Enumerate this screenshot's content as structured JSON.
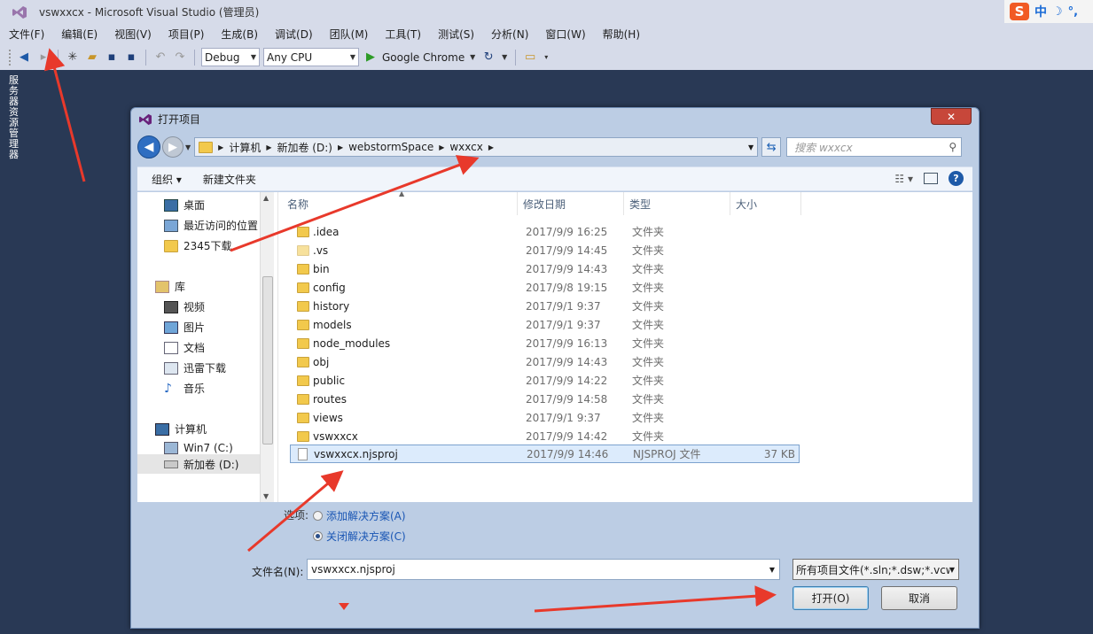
{
  "window": {
    "title": "vswxxcx - Microsoft Visual Studio (管理员)"
  },
  "ime": {
    "logo": "S",
    "lang": "中",
    "moon": "☽",
    "punct": "°,"
  },
  "menu": [
    "文件(F)",
    "编辑(E)",
    "视图(V)",
    "项目(P)",
    "生成(B)",
    "调试(D)",
    "团队(M)",
    "工具(T)",
    "测试(S)",
    "分析(N)",
    "窗口(W)",
    "帮助(H)"
  ],
  "toolbar": {
    "config": "Debug",
    "platform": "Any CPU",
    "run_target": "Google Chrome"
  },
  "side_tab": {
    "label": "服务器资源管理器"
  },
  "dialog": {
    "title": "打开项目",
    "close": "✕",
    "breadcrumb": [
      "计算机",
      "新加卷 (D:)",
      "webstormSpace",
      "wxxcx"
    ],
    "search_placeholder": "搜索 wxxcx",
    "organize": "组织 ▾",
    "new_folder": "新建文件夹",
    "help": "?",
    "nav": {
      "favorites": [
        "桌面",
        "最近访问的位置",
        "2345下载"
      ],
      "library": "库",
      "libraries": [
        "视频",
        "图片",
        "文档",
        "迅雷下载",
        "音乐"
      ],
      "computer": "计算机",
      "drives": [
        "Win7 (C:)",
        "新加卷 (D:)"
      ]
    },
    "columns": [
      "名称",
      "修改日期",
      "类型",
      "大小"
    ],
    "files": [
      {
        "name": ".idea",
        "date": "2017/9/9 16:25",
        "type": "文件夹",
        "size": ""
      },
      {
        "name": ".vs",
        "date": "2017/9/9 14:45",
        "type": "文件夹",
        "size": ""
      },
      {
        "name": "bin",
        "date": "2017/9/9 14:43",
        "type": "文件夹",
        "size": ""
      },
      {
        "name": "config",
        "date": "2017/9/8 19:15",
        "type": "文件夹",
        "size": ""
      },
      {
        "name": "history",
        "date": "2017/9/1 9:37",
        "type": "文件夹",
        "size": ""
      },
      {
        "name": "models",
        "date": "2017/9/1 9:37",
        "type": "文件夹",
        "size": ""
      },
      {
        "name": "node_modules",
        "date": "2017/9/9 16:13",
        "type": "文件夹",
        "size": ""
      },
      {
        "name": "obj",
        "date": "2017/9/9 14:43",
        "type": "文件夹",
        "size": ""
      },
      {
        "name": "public",
        "date": "2017/9/9 14:22",
        "type": "文件夹",
        "size": ""
      },
      {
        "name": "routes",
        "date": "2017/9/9 14:58",
        "type": "文件夹",
        "size": ""
      },
      {
        "name": "views",
        "date": "2017/9/1 9:37",
        "type": "文件夹",
        "size": ""
      },
      {
        "name": "vswxxcx",
        "date": "2017/9/9 14:42",
        "type": "文件夹",
        "size": ""
      },
      {
        "name": "vswxxcx.njsproj",
        "date": "2017/9/9 14:46",
        "type": "NJSPROJ 文件",
        "size": "37 KB"
      }
    ],
    "options_label": "选项:",
    "radio_add": "添加解决方案(A)",
    "radio_close": "关闭解决方案(C)",
    "filename_label": "文件名(N):",
    "filename_value": "vswxxcx.njsproj",
    "filter": "所有项目文件(*.sln;*.dsw;*.vcw",
    "open": "打开(O)",
    "cancel": "取消"
  },
  "colors": {
    "vs_chrome": "#d6dbe9",
    "vs_background": "#293955",
    "annotation": "#e8392b"
  }
}
